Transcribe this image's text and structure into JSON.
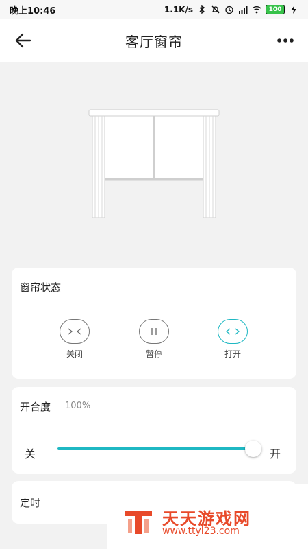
{
  "status_bar": {
    "time": "晚上10:46",
    "net_speed": "1.1K/s",
    "battery": "100"
  },
  "header": {
    "title": "客厅窗帘"
  },
  "curtain_status": {
    "title": "窗帘状态",
    "controls": [
      {
        "label": "关闭",
        "icon": "close-curtain-icon",
        "active": false
      },
      {
        "label": "暂停",
        "icon": "pause-icon",
        "active": false
      },
      {
        "label": "打开",
        "icon": "open-curtain-icon",
        "active": true
      }
    ]
  },
  "opening_degree": {
    "title": "开合度",
    "value": "100%",
    "level": 1.0,
    "min_label": "关",
    "max_label": "开"
  },
  "timer": {
    "title": "定时"
  },
  "watermark": {
    "name": "天天游戏网",
    "url": "www.ttyl23.com"
  },
  "colors": {
    "accent": "#1fb8c3",
    "watermark": "#e84a2a"
  }
}
